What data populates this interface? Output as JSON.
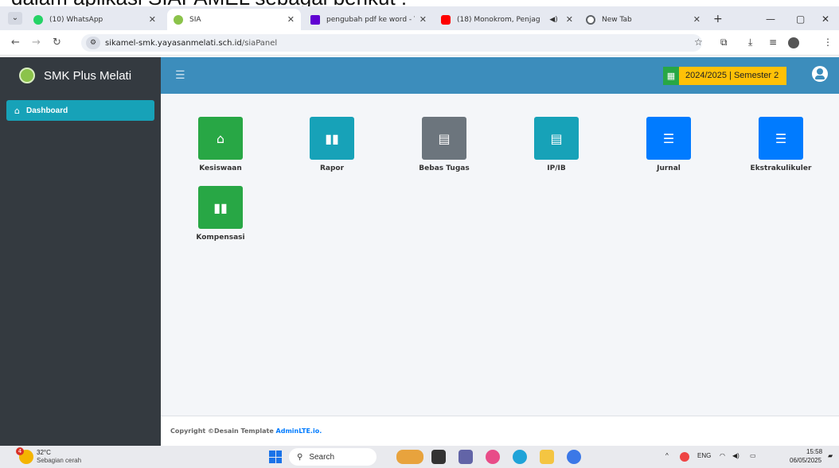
{
  "caption": "dalam aplikasi SIAPAMEL sebagai berikut :",
  "browser": {
    "tabs": [
      {
        "title": "(10) WhatsApp",
        "color": "#25d366"
      },
      {
        "title": "SIA",
        "color": "#8bc34a"
      },
      {
        "title": "pengubah pdf ke word - Yah",
        "color": "#6001d2"
      },
      {
        "title": "(18) Monokrom, Penjag",
        "color": "#ff0000"
      },
      {
        "title": "New Tab",
        "color": "#5f6368"
      }
    ],
    "url_domain": "sikamel-smk.yayasanmelati.sch.id",
    "url_path": "/siaPanel"
  },
  "app": {
    "brand": "SMK Plus Melati",
    "semester": "2024/2025 | Semester 2",
    "sidebar": {
      "items": [
        {
          "label": "Dashboard",
          "icon": "home-icon"
        }
      ]
    },
    "tiles": [
      {
        "label": "Kesiswaan",
        "color": "#28a745",
        "icon": "house-icon"
      },
      {
        "label": "Rapor",
        "color": "#17a2b8",
        "icon": "book-icon"
      },
      {
        "label": "Bebas Tugas",
        "color": "#6c757d",
        "icon": "file-icon"
      },
      {
        "label": "IP/IB",
        "color": "#17a2b8",
        "icon": "file-icon"
      },
      {
        "label": "Jurnal",
        "color": "#007bff",
        "icon": "journal-icon"
      },
      {
        "label": "Ekstrakulikuler",
        "color": "#007bff",
        "icon": "journal-icon"
      },
      {
        "label": "Kompensasi",
        "color": "#28a745",
        "icon": "book-icon"
      }
    ],
    "footer_prefix": "Copyright ©Desain Template ",
    "footer_link": "AdminLTE.io."
  },
  "taskbar": {
    "weather_temp": "32°C",
    "weather_desc": "Sebagian cerah",
    "weather_badge": "4",
    "search": "Search",
    "lang": "ENG",
    "time": "15:58",
    "date": "06/05/2025"
  }
}
